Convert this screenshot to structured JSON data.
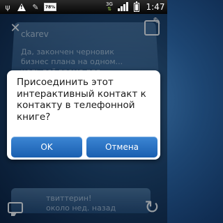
{
  "status_bar": {
    "icons": [
      "usb-icon",
      "warning-icon",
      "tool-icon",
      "battery-percent-icon",
      "3g-icon",
      "signal-icon",
      "battery-icon"
    ],
    "battery_small_label": "78%",
    "network_label": "3G",
    "time": "1:47"
  },
  "background": {
    "card_name": "ckarev",
    "card_text": "Да, закончен черновик бизнес плана на одном... цель всё время для...",
    "bottom_text_1": "твиттерин!",
    "bottom_text_2": "около нед. назад"
  },
  "dialog": {
    "message": "Присоединить этот интерактивный контакт к контакту в телефонной книге?",
    "ok_label": "OK",
    "cancel_label": "Отмена"
  },
  "colors": {
    "dialog_button": "#2a73c4",
    "background": "#1d4673"
  }
}
